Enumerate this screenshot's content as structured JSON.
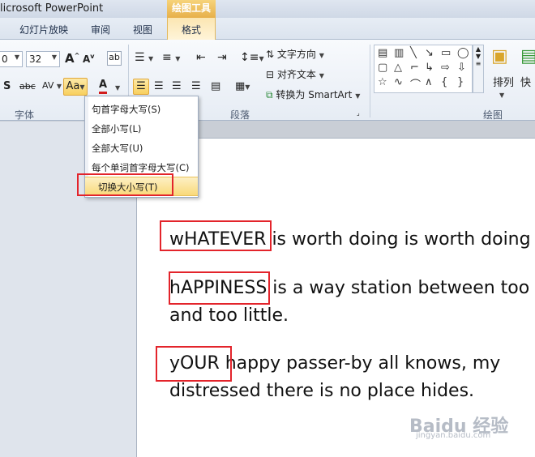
{
  "window": {
    "title": "licrosoft PowerPoint"
  },
  "tool_tab_header": "绘图工具",
  "tabs": [
    {
      "label": "幻灯片放映"
    },
    {
      "label": "审阅"
    },
    {
      "label": "视图"
    },
    {
      "label": "格式"
    }
  ],
  "ribbon": {
    "font_name_value": "0",
    "font_size_value": "32",
    "grow_font": "A",
    "shrink_font": "A",
    "change_case_label": "Aa",
    "font_color_label": "A",
    "shadow_label": "S",
    "strike_label": "abc",
    "spacing_label": "AV",
    "text_direction": "文字方向",
    "align_text": "对齐文本",
    "convert_smartart": "转换为 SmartArt",
    "arrange": "排列",
    "quick_styles": "快",
    "groups": {
      "font": "字体",
      "paragraph": "段落",
      "drawing": "绘图"
    }
  },
  "case_menu": {
    "items": [
      {
        "label": "句首字母大写(S)"
      },
      {
        "label": "全部小写(L)"
      },
      {
        "label": "全部大写(U)"
      },
      {
        "label": "每个单词首字母大写(C)"
      },
      {
        "label": "切换大小写(T)"
      }
    ]
  },
  "slide": {
    "p1": {
      "word": "wHATEVER",
      "rest": " is worth doing is worth doing"
    },
    "p2": {
      "word": "hAPPINESS",
      "rest": " is a way station between too",
      "line2": "and too little."
    },
    "p3": {
      "word": "yOUR",
      "rest": " happy passer-by all knows, my",
      "line2": "distressed there is no place hides."
    }
  },
  "watermark": {
    "logo": "Baidu 经验",
    "sub": "jingyan.baidu.com"
  },
  "colors": {
    "highlight_box": "#e3242b",
    "menu_hover": "#f9d97a",
    "tool_tab": "#e7b04a"
  }
}
